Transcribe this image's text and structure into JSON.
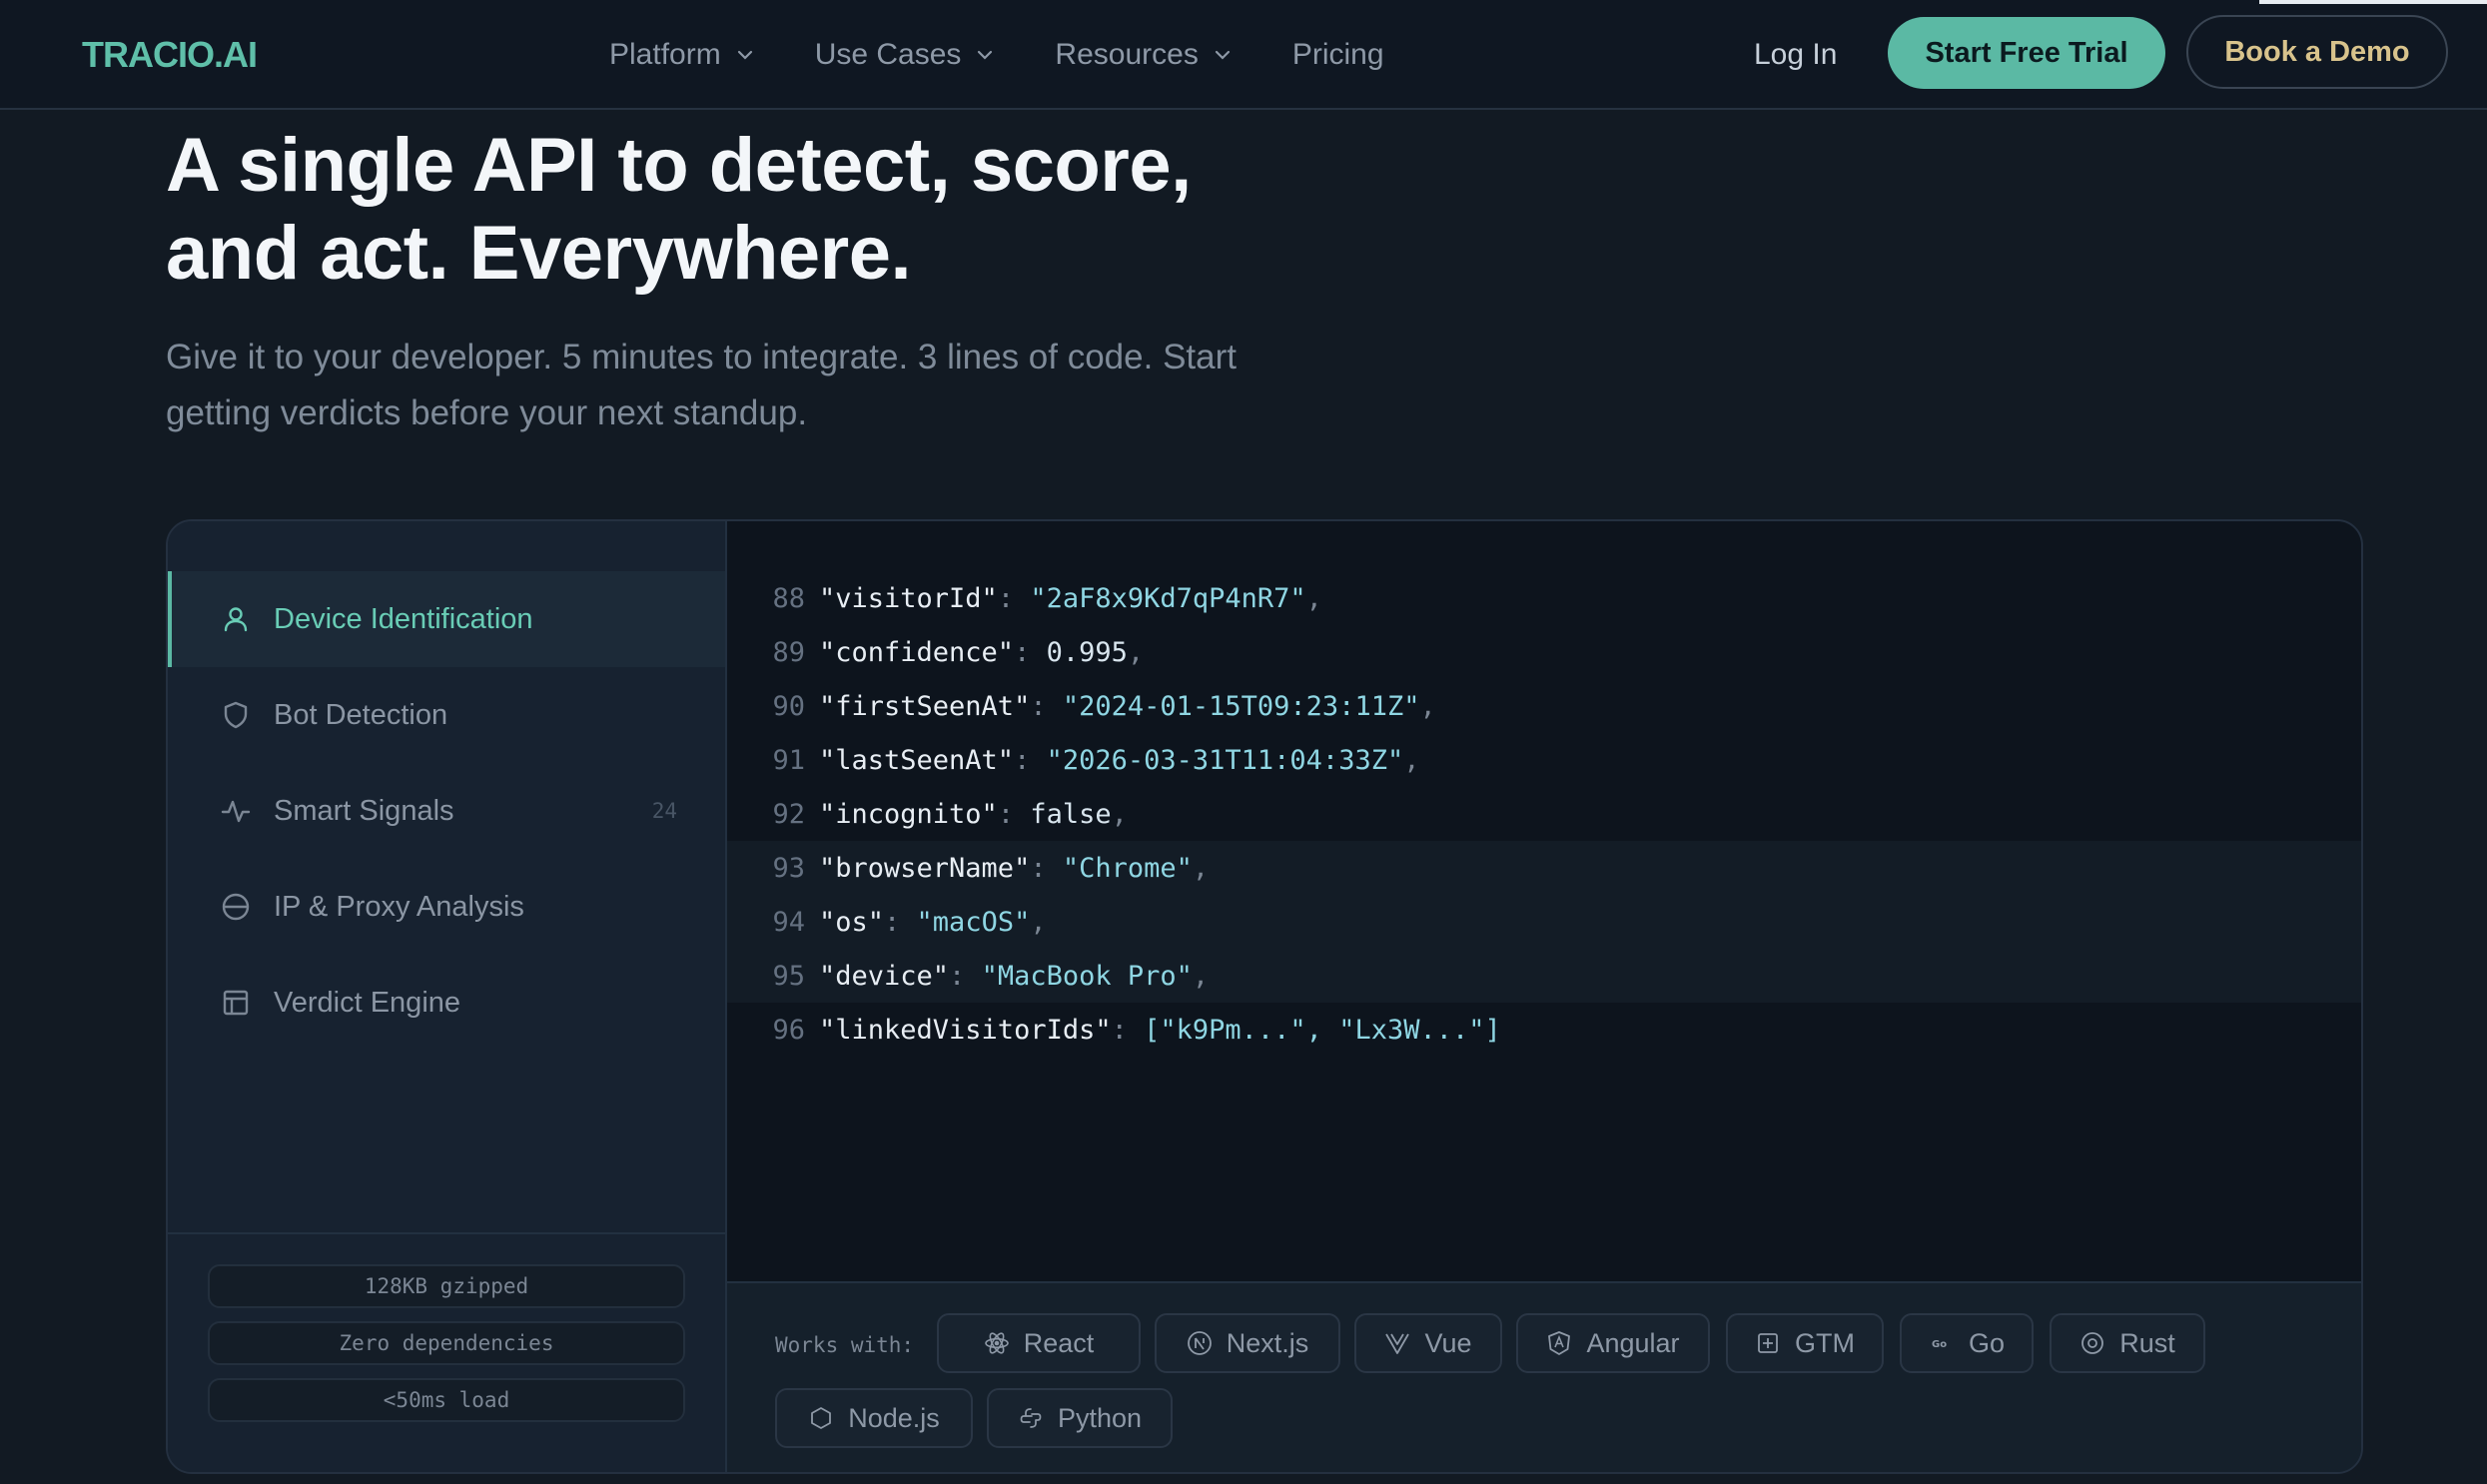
{
  "nav": {
    "logo": "TRACIO.AI",
    "links": [
      {
        "label": "Platform",
        "dropdown": true
      },
      {
        "label": "Use Cases",
        "dropdown": true
      },
      {
        "label": "Resources",
        "dropdown": true
      },
      {
        "label": "Pricing",
        "dropdown": false
      }
    ],
    "login": "Log In",
    "trial_button": "Start Free Trial",
    "demo_button": "Book a Demo"
  },
  "hero": {
    "title_line1": "A single API to detect, score,",
    "title_line2": "and act. Everywhere.",
    "subtitle_line1": "Give it to your developer. 5 minutes to integrate. 3 lines of code. Start",
    "subtitle_line2": "getting verdicts before your next standup."
  },
  "sidebar": {
    "items": [
      {
        "label": "Device Identification",
        "icon": "user-icon",
        "active": true
      },
      {
        "label": "Bot Detection",
        "icon": "shield-icon",
        "active": false
      },
      {
        "label": "Smart Signals",
        "icon": "activity-icon",
        "active": false,
        "count": "24"
      },
      {
        "label": "IP & Proxy Analysis",
        "icon": "globe-icon",
        "active": false
      },
      {
        "label": "Verdict Engine",
        "icon": "table-icon",
        "active": false
      }
    ],
    "stats": [
      "128KB gzipped",
      "Zero dependencies",
      "<50ms load"
    ]
  },
  "code": {
    "lines": [
      {
        "no": "88",
        "key": "\"visitorId\"",
        "value": "\"2aF8x9Kd7qP4nR7\"",
        "type": "string"
      },
      {
        "no": "89",
        "key": "\"confidence\"",
        "value": "0.995",
        "type": "number"
      },
      {
        "no": "90",
        "key": "\"firstSeenAt\"",
        "value": "\"2024-01-15T09:23:11Z\"",
        "type": "string"
      },
      {
        "no": "91",
        "key": "\"lastSeenAt\"",
        "value": "\"2026-03-31T11:04:33Z\"",
        "type": "string"
      },
      {
        "no": "92",
        "key": "\"incognito\"",
        "value": "false",
        "type": "bool"
      },
      {
        "no": "93",
        "key": "\"browserName\"",
        "value": "\"Chrome\"",
        "type": "string",
        "highlight": true
      },
      {
        "no": "94",
        "key": "\"os\"",
        "value": "\"macOS\"",
        "type": "string",
        "highlight": true
      },
      {
        "no": "95",
        "key": "\"device\"",
        "value": "\"MacBook Pro\"",
        "type": "string",
        "highlight": true
      },
      {
        "no": "96",
        "key": "\"linkedVisitorIds\"",
        "value": "[\"k9Pm...\", \"Lx3W...\"]",
        "type": "array"
      }
    ]
  },
  "works_with": {
    "label": "Works with:",
    "items": [
      {
        "label": "React",
        "icon": "react-icon"
      },
      {
        "label": "Next.js",
        "icon": "nextjs-icon"
      },
      {
        "label": "Vue",
        "icon": "vue-icon"
      },
      {
        "label": "Angular",
        "icon": "angular-icon"
      },
      {
        "label": "GTM",
        "icon": "gtm-icon"
      },
      {
        "label": "Go",
        "icon": "go-icon"
      },
      {
        "label": "Rust",
        "icon": "rust-icon"
      },
      {
        "label": "Node.js",
        "icon": "nodejs-icon"
      },
      {
        "label": "Python",
        "icon": "python-icon"
      }
    ]
  },
  "colors": {
    "accent": "#5bb9a4",
    "background": "#121a23",
    "demo_text": "#d8c38c"
  }
}
